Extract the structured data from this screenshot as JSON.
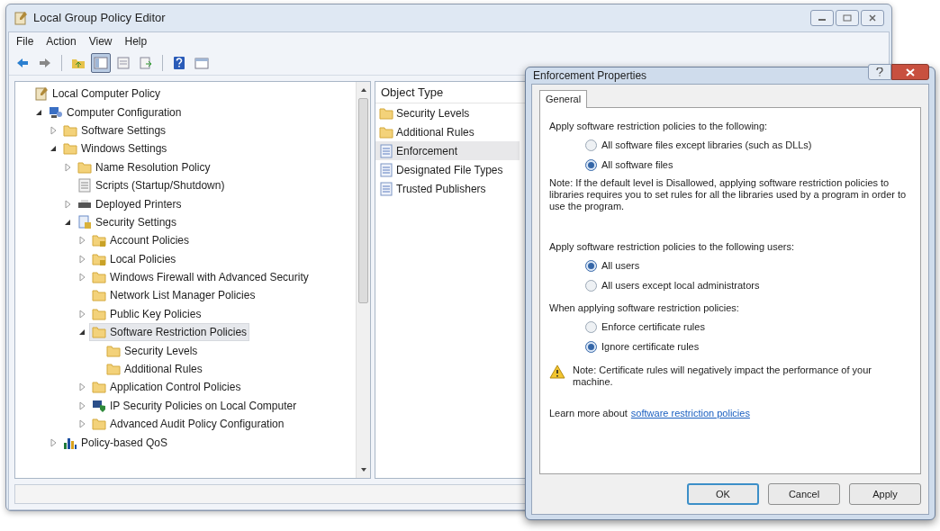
{
  "window": {
    "title": "Local Group Policy Editor"
  },
  "menu": [
    "File",
    "Action",
    "View",
    "Help"
  ],
  "toolbar": [
    [
      {
        "kind": "back",
        "pressed": false
      },
      {
        "kind": "forward",
        "pressed": false
      }
    ],
    [
      {
        "kind": "up",
        "pressed": false
      },
      {
        "kind": "tree",
        "pressed": true
      },
      {
        "kind": "props",
        "pressed": false
      },
      {
        "kind": "export",
        "pressed": false
      }
    ],
    [
      {
        "kind": "help",
        "pressed": false
      },
      {
        "kind": "console",
        "pressed": false
      }
    ]
  ],
  "tree": [
    {
      "label": "Local Computer Policy",
      "kind": "policy",
      "selected": false,
      "children": [
        {
          "label": "Computer Configuration",
          "kind": "computer",
          "expanded": true,
          "selected": false,
          "children": [
            {
              "label": "Software Settings",
              "kind": "folder",
              "expanded": false,
              "selected": false
            },
            {
              "label": "Windows Settings",
              "kind": "folder",
              "expanded": true,
              "selected": false,
              "children": [
                {
                  "label": "Name Resolution Policy",
                  "kind": "folder",
                  "expanded": false,
                  "selected": false
                },
                {
                  "label": "Scripts (Startup/Shutdown)",
                  "kind": "scripts",
                  "selected": false
                },
                {
                  "label": "Deployed Printers",
                  "kind": "printer",
                  "expanded": false,
                  "selected": false
                },
                {
                  "label": "Security Settings",
                  "kind": "security",
                  "expanded": true,
                  "selected": false,
                  "children": [
                    {
                      "label": "Account Policies",
                      "kind": "folder-lock",
                      "expanded": false,
                      "selected": false
                    },
                    {
                      "label": "Local Policies",
                      "kind": "folder-lock",
                      "expanded": false,
                      "selected": false
                    },
                    {
                      "label": "Windows Firewall with Advanced Security",
                      "kind": "folder",
                      "expanded": false,
                      "selected": false
                    },
                    {
                      "label": "Network List Manager Policies",
                      "kind": "folder",
                      "selected": false
                    },
                    {
                      "label": "Public Key Policies",
                      "kind": "folder",
                      "expanded": false,
                      "selected": false
                    },
                    {
                      "label": "Software Restriction Policies",
                      "kind": "folder",
                      "expanded": true,
                      "selected": true,
                      "children": [
                        {
                          "label": "Security Levels",
                          "kind": "folder",
                          "selected": false
                        },
                        {
                          "label": "Additional Rules",
                          "kind": "folder",
                          "selected": false
                        }
                      ]
                    },
                    {
                      "label": "Application Control Policies",
                      "kind": "folder",
                      "expanded": false,
                      "selected": false
                    },
                    {
                      "label": "IP Security Policies on Local Computer",
                      "kind": "ip",
                      "expanded": false,
                      "selected": false
                    },
                    {
                      "label": "Advanced Audit Policy Configuration",
                      "kind": "folder",
                      "expanded": false,
                      "selected": false
                    }
                  ]
                }
              ]
            },
            {
              "label": "Policy-based QoS",
              "kind": "qos",
              "expanded": false,
              "selected": false
            }
          ]
        }
      ]
    }
  ],
  "list": {
    "column": "Object Type",
    "items": [
      {
        "label": "Security Levels",
        "kind": "folder",
        "selected": false
      },
      {
        "label": "Additional Rules",
        "kind": "folder",
        "selected": false
      },
      {
        "label": "Enforcement",
        "kind": "doc",
        "selected": true
      },
      {
        "label": "Designated File Types",
        "kind": "doc",
        "selected": false
      },
      {
        "label": "Trusted Publishers",
        "kind": "doc",
        "selected": false
      }
    ]
  },
  "dialog": {
    "title": "Enforcement Properties",
    "tabs": [
      {
        "label": "General",
        "selected": true
      }
    ],
    "sections": [
      {
        "heading": "Apply software restriction policies to the following:",
        "options": [
          {
            "label": "All software files except libraries (such as DLLs)",
            "selected": false
          },
          {
            "label": "All software files",
            "selected": true
          }
        ],
        "note": "Note:  If the default level is Disallowed, applying software restriction policies to libraries requires you to set rules for all the libraries used by a program in order to use the program."
      },
      {
        "heading": "Apply software restriction policies to the following users:",
        "options": [
          {
            "label": "All users",
            "selected": true
          },
          {
            "label": "All users except local administrators",
            "selected": false
          }
        ]
      },
      {
        "heading": "When applying software restriction policies:",
        "options": [
          {
            "label": "Enforce certificate rules",
            "selected": false
          },
          {
            "label": "Ignore certificate rules",
            "selected": true
          }
        ]
      }
    ],
    "warning": "Note:  Certificate rules will negatively impact the performance of your machine.",
    "learn_more": {
      "text": "Learn more about",
      "link": "software restriction policies"
    },
    "buttons": [
      {
        "label": "OK",
        "default": true
      },
      {
        "label": "Cancel",
        "default": false
      },
      {
        "label": "Apply",
        "default": false
      }
    ]
  }
}
